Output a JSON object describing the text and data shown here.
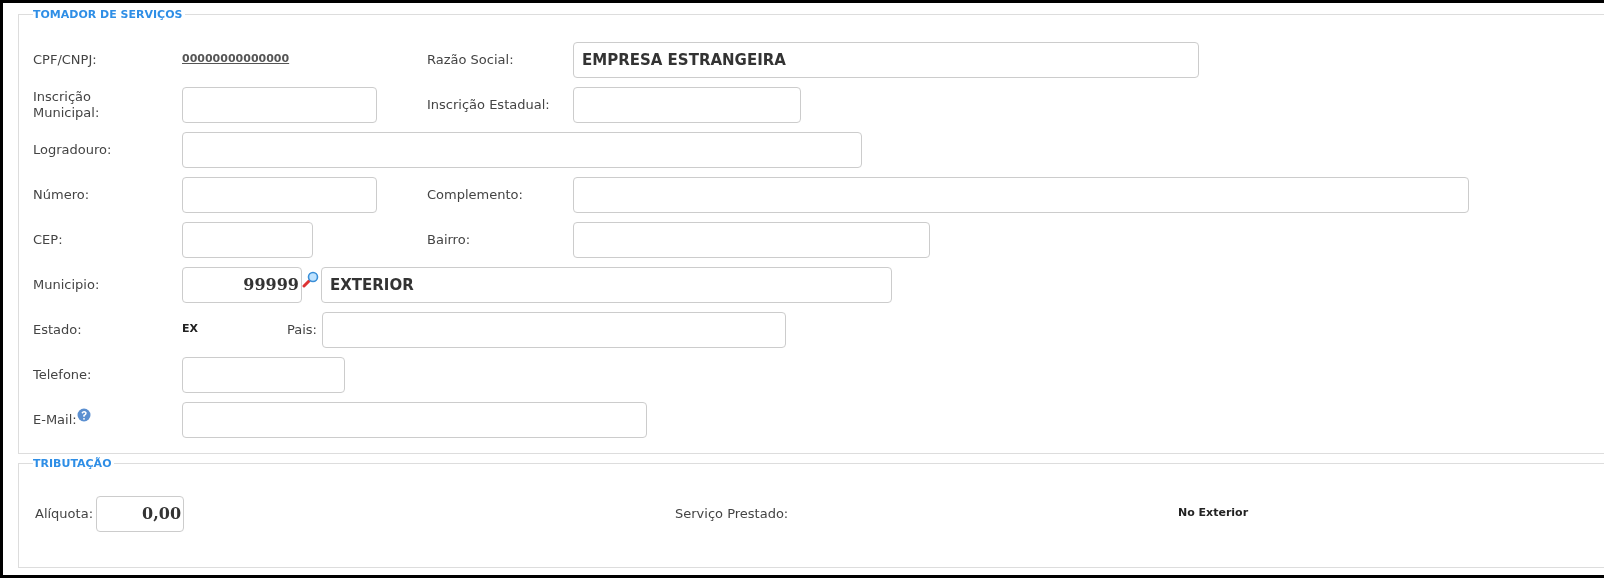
{
  "sections": [
    {
      "legend": "TOMADOR DE SERVIÇOS",
      "rows": [
        [
          {
            "kind": "link",
            "label": "CPF/CNPJ:",
            "value": "00000000000000"
          },
          {
            "kind": "input",
            "label": "Razão Social:",
            "value": "EMPRESA ESTRANGEIRA"
          }
        ],
        [
          {
            "kind": "input",
            "label": "Inscrição Municipal:"
          },
          {
            "kind": "input",
            "label": "Inscrição Estadual:"
          }
        ],
        [
          {
            "kind": "input",
            "label": "Logradouro:"
          }
        ],
        [
          {
            "kind": "input",
            "label": "Número:"
          },
          {
            "kind": "input",
            "label": "Complemento:"
          }
        ],
        [
          {
            "kind": "input",
            "label": "CEP:"
          },
          {
            "kind": "input",
            "label": "Bairro:"
          }
        ],
        [
          {
            "kind": "lookup",
            "label": "Municipio:",
            "code": "99999",
            "value": "EXTERIOR"
          }
        ],
        [
          {
            "kind": "text",
            "label": "Estado:",
            "value": "EX"
          },
          {
            "kind": "input",
            "label": "Pais:"
          }
        ],
        [
          {
            "kind": "input",
            "label": "Telefone:"
          }
        ],
        [
          {
            "kind": "input",
            "label": "E-Mail:",
            "help": true
          }
        ]
      ]
    },
    {
      "legend": "TRIBUTAÇÃO",
      "rows": [
        [
          {
            "kind": "number",
            "label": "Alíquota:",
            "value": "0,00"
          },
          {
            "kind": "text",
            "label": "Serviço Prestado:",
            "value": "No Exterior"
          }
        ]
      ]
    }
  ]
}
